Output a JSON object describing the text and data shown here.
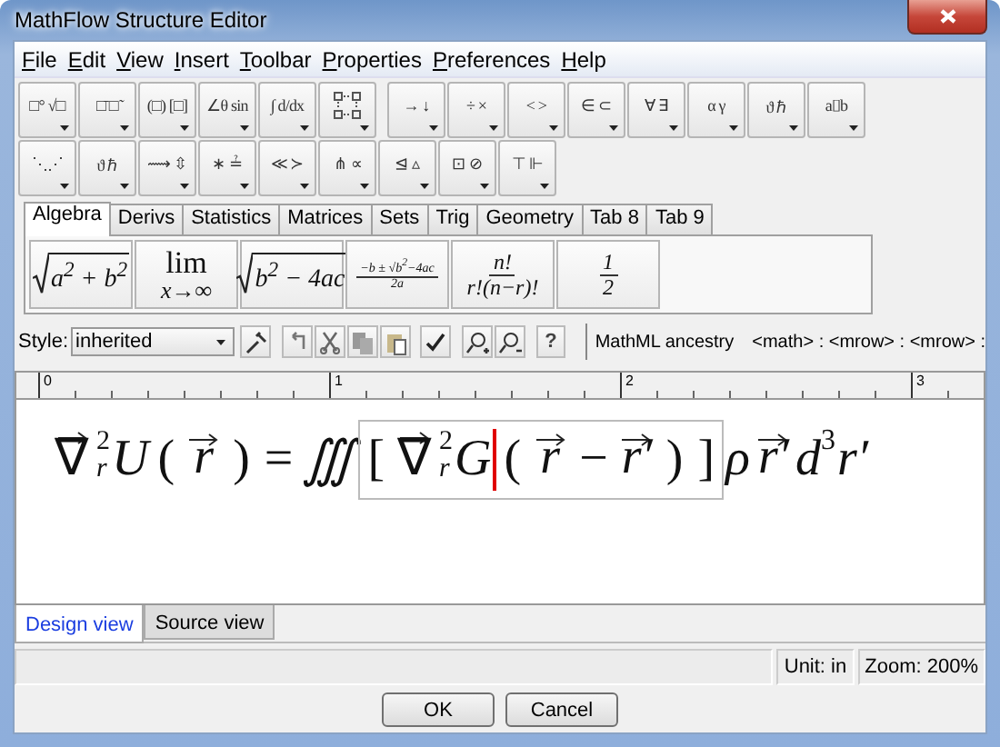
{
  "window": {
    "title": "MathFlow Structure Editor"
  },
  "menu": [
    {
      "label": "File",
      "mnemonic": true
    },
    {
      "label": "Edit",
      "mnemonic": true
    },
    {
      "label": "View",
      "mnemonic": true
    },
    {
      "label": "Insert",
      "mnemonic": true
    },
    {
      "label": "Toolbar",
      "mnemonic": true
    },
    {
      "label": "Properties",
      "mnemonic": true
    },
    {
      "label": "Preferences",
      "mnemonic": true
    },
    {
      "label": "Help",
      "mnemonic": true
    }
  ],
  "palette_rows": [
    [
      {
        "kind": "glyphs",
        "label": "□° √□"
      },
      {
        "kind": "glyphs",
        "label": "□̄ □̃"
      },
      {
        "kind": "glyphs",
        "label": "(□) [□]"
      },
      {
        "kind": "glyphs",
        "label": "∠θ sin"
      },
      {
        "kind": "glyphs",
        "label": "∫ d/dx"
      },
      {
        "kind": "matrix"
      },
      {
        "kind": "glyphs",
        "label": "→ ↓"
      },
      {
        "kind": "glyphs",
        "label": "÷ ×"
      },
      {
        "kind": "glyphs",
        "label": "< >"
      },
      {
        "kind": "glyphs",
        "label": "∈ ⊂"
      },
      {
        "kind": "glyphs",
        "label": "∀ ∃"
      },
      {
        "kind": "glyphs",
        "label": "α γ"
      },
      {
        "kind": "glyphs",
        "label": "ϑ ℏ"
      },
      {
        "kind": "glyphs",
        "label": "a⌷b"
      }
    ],
    [
      {
        "kind": "glyphs",
        "label": "⋱⋰"
      },
      {
        "kind": "glyphs",
        "label": "ϑ ℏ"
      },
      {
        "kind": "glyphs",
        "label": "⟿ ⇳"
      },
      {
        "kind": "glyphs",
        "label": "∗ ≟"
      },
      {
        "kind": "glyphs",
        "label": "≪ ≻"
      },
      {
        "kind": "glyphs",
        "label": "⋔ ∝"
      },
      {
        "kind": "glyphs",
        "label": "⊴ ▵"
      },
      {
        "kind": "glyphs",
        "label": "⊡ ⊘"
      },
      {
        "kind": "glyphs",
        "label": "⊤ ⊩"
      }
    ]
  ],
  "template_tabs": [
    {
      "label": "Algebra",
      "selected": true
    },
    {
      "label": "Derivs",
      "selected": false
    },
    {
      "label": "Statistics",
      "selected": false
    },
    {
      "label": "Matrices",
      "selected": false
    },
    {
      "label": "Sets",
      "selected": false
    },
    {
      "label": "Trig",
      "selected": false
    },
    {
      "label": "Geometry",
      "selected": false
    },
    {
      "label": "Tab 8",
      "selected": false
    },
    {
      "label": "Tab 9",
      "selected": false
    }
  ],
  "templates": [
    {
      "kind": "sqrt",
      "body": "a$^{2}$ + b$^{2}$"
    },
    {
      "kind": "limit",
      "top": "lim",
      "bottom": "x→∞"
    },
    {
      "kind": "sqrt",
      "body": "b$^{2}$ − 4ac"
    },
    {
      "kind": "fraction",
      "numerator": "−b ± √b$^{2}$−4ac",
      "denominator": "2a"
    },
    {
      "kind": "fraction",
      "numerator": "n!",
      "denominator": "r!(n−r)!"
    },
    {
      "kind": "fraction",
      "numerator": "1",
      "denominator": "2"
    }
  ],
  "style_bar": {
    "label": "Style:",
    "value": "inherited",
    "help": "?"
  },
  "ancestry": {
    "label": "MathML ancestry",
    "path": "<math> : <mrow> : <mrow> :"
  },
  "ruler": {
    "labels": [
      "0",
      "1",
      "2",
      "3"
    ]
  },
  "equation": [
    {
      "kind": "nabla",
      "base": "∇",
      "sup": "2",
      "sub": "r"
    },
    {
      "kind": "var",
      "text": "U"
    },
    {
      "kind": "op",
      "text": "("
    },
    {
      "kind": "vector",
      "text": "r"
    },
    {
      "kind": "op",
      "text": ")"
    },
    {
      "kind": "op",
      "text": "="
    },
    {
      "kind": "var",
      "text": "∭"
    },
    {
      "kind": "group",
      "children": [
        {
          "kind": "op",
          "text": "["
        },
        {
          "kind": "nabla",
          "base": "∇",
          "sup": "2",
          "sub": "r"
        },
        {
          "kind": "var",
          "text": "G"
        },
        {
          "kind": "caret"
        },
        {
          "kind": "op",
          "text": "("
        },
        {
          "kind": "vector",
          "text": "r"
        },
        {
          "kind": "op",
          "text": "−"
        },
        {
          "kind": "vector",
          "text": "r′"
        },
        {
          "kind": "op",
          "text": ")"
        },
        {
          "kind": "op",
          "text": "]"
        }
      ]
    },
    {
      "kind": "var",
      "text": "ρ"
    },
    {
      "kind": "vector",
      "text": "r′"
    },
    {
      "kind": "power",
      "base": "d",
      "sup": "3"
    },
    {
      "kind": "var",
      "text": "r′"
    }
  ],
  "view_tabs": [
    {
      "label": "Design view",
      "selected": true
    },
    {
      "label": "Source view",
      "selected": false
    }
  ],
  "status_bar": {
    "unit": "Unit: in",
    "zoom": "Zoom: 200%"
  },
  "buttons": [
    "OK",
    "Cancel"
  ]
}
